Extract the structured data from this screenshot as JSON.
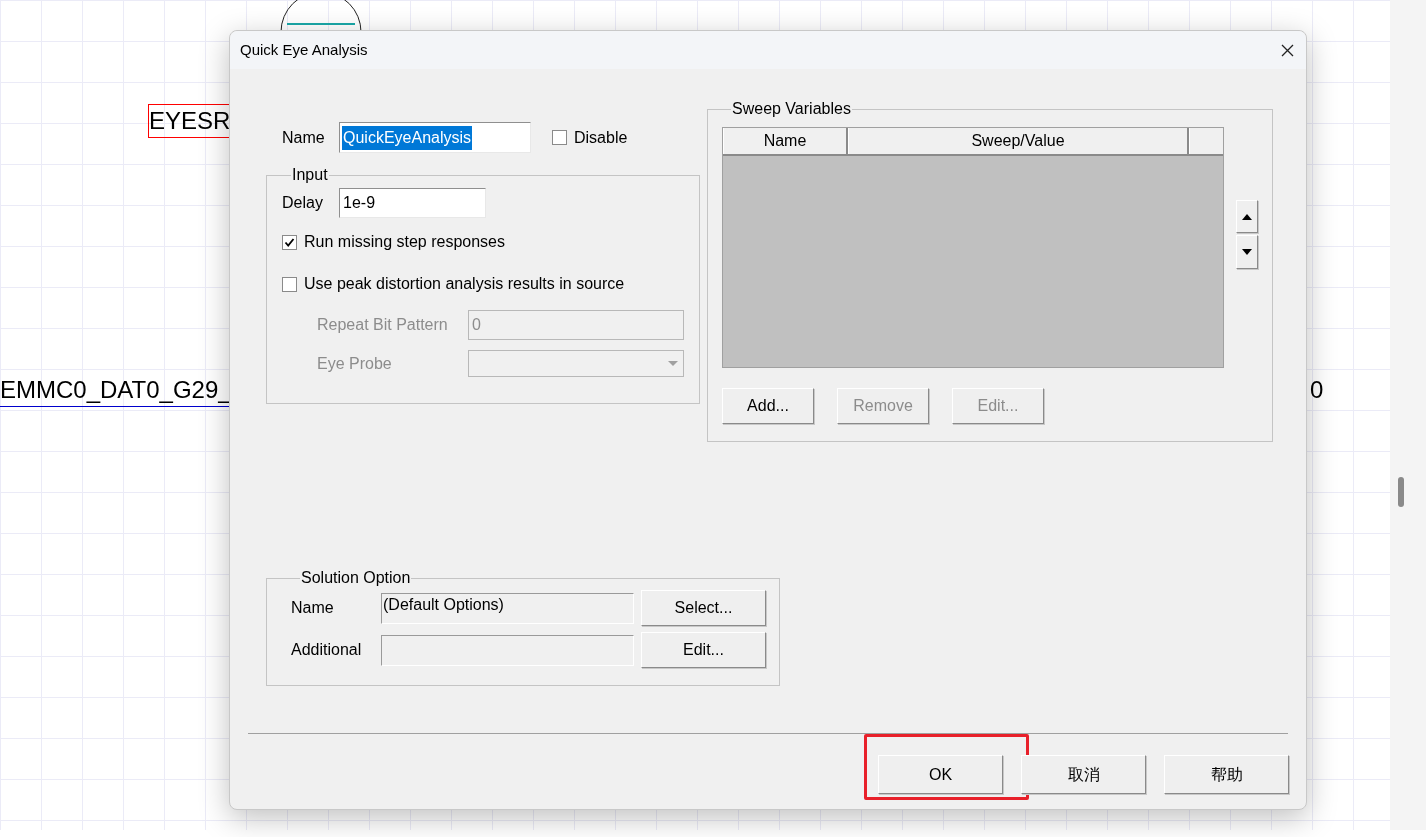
{
  "canvas": {
    "labels": [
      {
        "text": "EYESR",
        "kind": "boxed"
      },
      {
        "text": "EMMC0_DAT0_G29_",
        "kind": "underlined"
      },
      {
        "text": "0",
        "kind": "plain"
      }
    ]
  },
  "dialog": {
    "title": "Quick Eye Analysis",
    "name": {
      "label": "Name",
      "value": "QuickEyeAnalysis",
      "text_selected": true
    },
    "disable": {
      "label": "Disable",
      "checked": false
    },
    "input": {
      "title": "Input",
      "delay": {
        "label": "Delay",
        "value": "1e-9"
      },
      "options": [
        {
          "label": "Run missing step responses",
          "checked": true
        },
        {
          "label": "Use peak distortion analysis results in source",
          "checked": false
        }
      ],
      "repeat_bit_pattern": {
        "label": "Repeat Bit Pattern",
        "value": "0",
        "disabled": true
      },
      "eye_probe": {
        "label": "Eye Probe",
        "disabled": true
      }
    },
    "sweep": {
      "title": "Sweep Variables",
      "columns": [
        "Name",
        "Sweep/Value"
      ],
      "buttons": [
        {
          "label": "Add...",
          "disabled": false
        },
        {
          "label": "Remove",
          "disabled": true
        },
        {
          "label": "Edit...",
          "disabled": true
        }
      ]
    },
    "solution": {
      "title": "Solution Option",
      "name": {
        "label": "Name",
        "value": "(Default Options)"
      },
      "additional": {
        "label": "Additional"
      },
      "buttons": [
        "Select...",
        "Edit..."
      ]
    },
    "footer_buttons": [
      {
        "label": "OK",
        "highlighted": true
      },
      {
        "label": "取消",
        "highlighted": false
      },
      {
        "label": "帮助",
        "highlighted": false
      }
    ]
  }
}
